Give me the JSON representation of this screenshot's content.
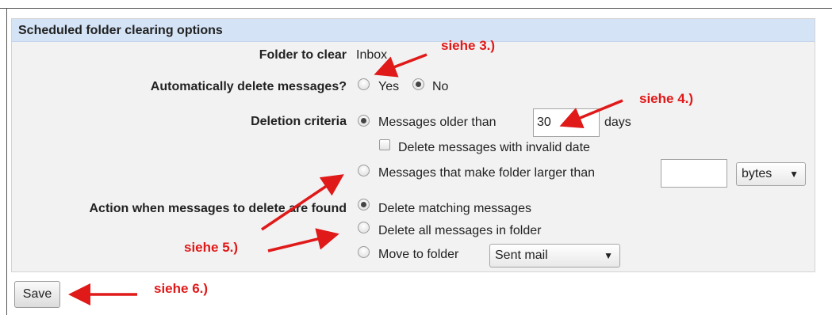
{
  "panel": {
    "title": "Scheduled folder clearing options"
  },
  "folder_to_clear": {
    "label": "Folder to clear",
    "value": "Inbox"
  },
  "auto_delete": {
    "label": "Automatically delete messages?",
    "yes_label": "Yes",
    "no_label": "No",
    "selected": "No"
  },
  "deletion_criteria": {
    "label": "Deletion criteria",
    "older_than_label": "Messages older than",
    "older_than_value": "30",
    "days_label": "days",
    "invalid_date_label": "Delete messages with invalid date",
    "invalid_date_checked": false,
    "larger_than_label": "Messages that make folder larger than",
    "larger_than_value": "",
    "unit_selected": "bytes",
    "selected": "older_than"
  },
  "action": {
    "label": "Action when messages to delete are found",
    "delete_matching_label": "Delete matching messages",
    "delete_all_label": "Delete all messages in folder",
    "move_to_label": "Move to folder",
    "move_folder_selected": "Sent mail",
    "selected": "delete_matching"
  },
  "save_label": "Save",
  "annotations": {
    "note3": "siehe 3.)",
    "note4": "siehe 4.)",
    "note5": "siehe 5.)",
    "note6": "siehe 6.)",
    "color": "#e01919"
  },
  "icons": {
    "dropdown": "triangle-down-icon"
  }
}
